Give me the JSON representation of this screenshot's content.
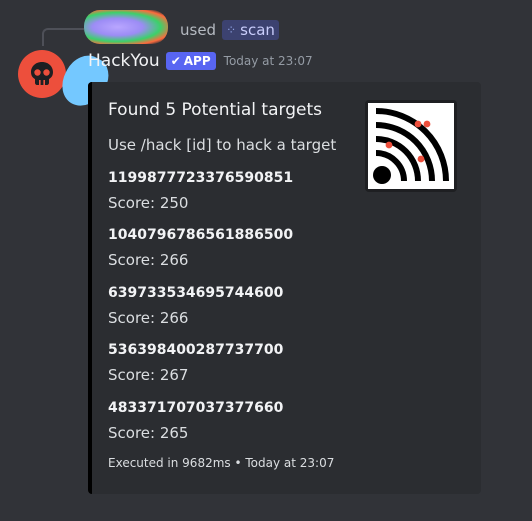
{
  "invocation": {
    "used_text": "used",
    "command_icon": "slash-command-icon",
    "command_name": "scan"
  },
  "message": {
    "author": "HackYou",
    "app_badge": "APP",
    "timestamp": "Today at 23:07"
  },
  "embed": {
    "title": "Found 5 Potential targets",
    "description": "Use /hack [id] to hack a target",
    "thumbnail_icon": "radar-signal-icon",
    "targets": [
      {
        "id": "1199877723376590851",
        "score": "Score: 250"
      },
      {
        "id": "1040796786561886500",
        "score": "Score: 266"
      },
      {
        "id": "639733534695744600",
        "score": "Score: 266"
      },
      {
        "id": "536398400287737700",
        "score": "Score: 267"
      },
      {
        "id": "483371707037377660",
        "score": "Score: 265"
      }
    ],
    "footer_exec": "Executed in 9682ms",
    "footer_time": "Today at 23:07"
  },
  "colors": {
    "background": "#313338",
    "embed_bg": "#2b2d31",
    "bot_avatar": "#ed4f3c",
    "app_badge": "#5865f2",
    "radar_dot": "#ed4f3c"
  }
}
